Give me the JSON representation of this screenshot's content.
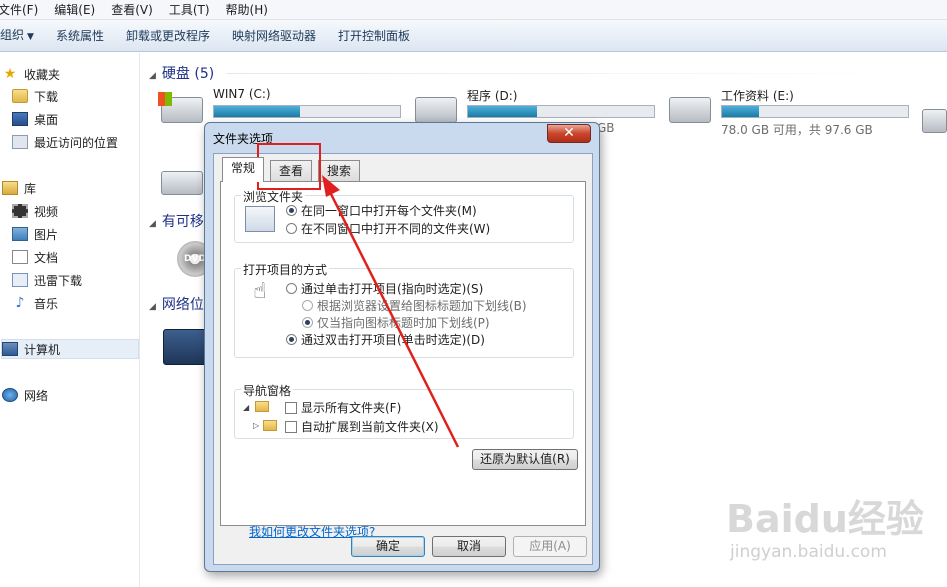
{
  "menubar": {
    "items": [
      "文件(F)",
      "编辑(E)",
      "查看(V)",
      "工具(T)",
      "帮助(H)"
    ]
  },
  "toolbar": {
    "organize": "组织",
    "caret": "▼",
    "buttons": [
      "系统属性",
      "卸载或更改程序",
      "映射网络驱动器",
      "打开控制面板"
    ]
  },
  "sidebar": {
    "favorites": "收藏夹",
    "fav_items": [
      "下载",
      "桌面",
      "最近访问的位置"
    ],
    "libraries": "库",
    "lib_items": [
      "视频",
      "图片",
      "文档",
      "迅雷下载",
      "音乐"
    ],
    "computer": "计算机",
    "network": "网络"
  },
  "main": {
    "hard_disks_title": "硬盘 (5)",
    "removable_title": "有可移",
    "network_title": "网络位",
    "drives": [
      {
        "name": "WIN7 (C:)",
        "used_fraction": 0.46,
        "free_text": ""
      },
      {
        "name": "程序 (D:)",
        "used_fraction": 0.37,
        "free_text": "GB"
      },
      {
        "name": "工作资料 (E:)",
        "used_fraction": 0.2,
        "free_text": "78.0 GB 可用，共 97.6 GB"
      }
    ],
    "dvd_label": "DVD"
  },
  "dialog": {
    "title": "文件夹选项",
    "close": "✕",
    "tabs": [
      "常规",
      "查看",
      "搜索"
    ],
    "browse_group": "浏览文件夹",
    "browse_opts": [
      "在同一窗口中打开每个文件夹(M)",
      "在不同窗口中打开不同的文件夹(W)"
    ],
    "click_group": "打开项目的方式",
    "click_opts": [
      "通过单击打开项目(指向时选定)(S)",
      "根据浏览器设置给图标标题加下划线(B)",
      "仅当指向图标标题时加下划线(P)",
      "通过双击打开项目(单击时选定)(D)"
    ],
    "nav_group": "导航窗格",
    "nav_opts": [
      "显示所有文件夹(F)",
      "自动扩展到当前文件夹(X)"
    ],
    "restore": "还原为默认值(R)",
    "help_link": "我如何更改文件夹选项?",
    "ok": "确定",
    "cancel": "取消",
    "apply": "应用(A)"
  },
  "watermark": {
    "logo": "Baidu经验",
    "url": "jingyan.baidu.com"
  },
  "colors": {
    "annotation": "#e0201e",
    "link": "#0066cc",
    "accent": "#1b7ca6"
  }
}
